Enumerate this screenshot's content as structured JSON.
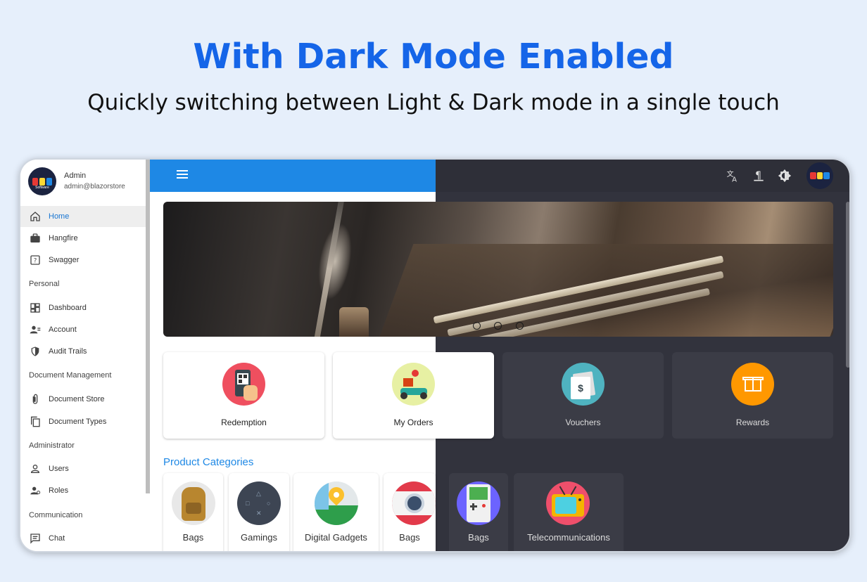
{
  "hero": {
    "title": "With Dark Mode Enabled",
    "subtitle": "Quickly switching  between Light & Dark mode in a single touch"
  },
  "colors": {
    "accent": "#1e88e5",
    "headline": "#1565e8",
    "dark_bg": "#32333d",
    "dark_card": "#3b3c46"
  },
  "profile": {
    "logo_text": "Software",
    "name": "Admin",
    "email": "admin@blazorstore"
  },
  "sidebar": {
    "items": [
      {
        "label": "Home",
        "icon": "home-icon",
        "active": true
      },
      {
        "label": "Hangfire",
        "icon": "briefcase-icon"
      },
      {
        "label": "Swagger",
        "icon": "help-icon"
      }
    ],
    "sections": [
      {
        "title": "Personal",
        "items": [
          {
            "label": "Dashboard",
            "icon": "dashboard-icon"
          },
          {
            "label": "Account",
            "icon": "account-icon"
          },
          {
            "label": "Audit Trails",
            "icon": "shield-icon"
          }
        ]
      },
      {
        "title": "Document Management",
        "items": [
          {
            "label": "Document Store",
            "icon": "attachment-icon"
          },
          {
            "label": "Document Types",
            "icon": "copy-icon"
          }
        ]
      },
      {
        "title": "Administrator",
        "items": [
          {
            "label": "Users",
            "icon": "user-icon"
          },
          {
            "label": "Roles",
            "icon": "roles-icon"
          }
        ]
      },
      {
        "title": "Communication",
        "items": [
          {
            "label": "Chat",
            "icon": "chat-icon"
          }
        ]
      }
    ]
  },
  "toolbar": {
    "icons": [
      "translate-icon",
      "rtl-icon",
      "theme-toggle-icon",
      "avatar"
    ]
  },
  "feature_cards": [
    {
      "label": "Redemption",
      "icon": "qr-phone-icon"
    },
    {
      "label": "My Orders",
      "icon": "delivery-scooter-icon"
    },
    {
      "label": "Vouchers",
      "icon": "voucher-icon"
    },
    {
      "label": "Rewards",
      "icon": "gift-icon"
    }
  ],
  "categories": {
    "title": "Product Categories",
    "items": [
      {
        "label": "Bags",
        "icon": "backpack-icon"
      },
      {
        "label": "Gamings",
        "icon": "gamepad-icon"
      },
      {
        "label": "Digital Gadgets",
        "icon": "map-pin-icon"
      },
      {
        "label": "Bags",
        "icon": "camera-icon"
      },
      {
        "label": "Bags",
        "icon": "gameboy-icon"
      },
      {
        "label": "Telecommunications",
        "icon": "tv-icon"
      }
    ]
  },
  "carousel": {
    "slides": 3,
    "active": 1
  }
}
